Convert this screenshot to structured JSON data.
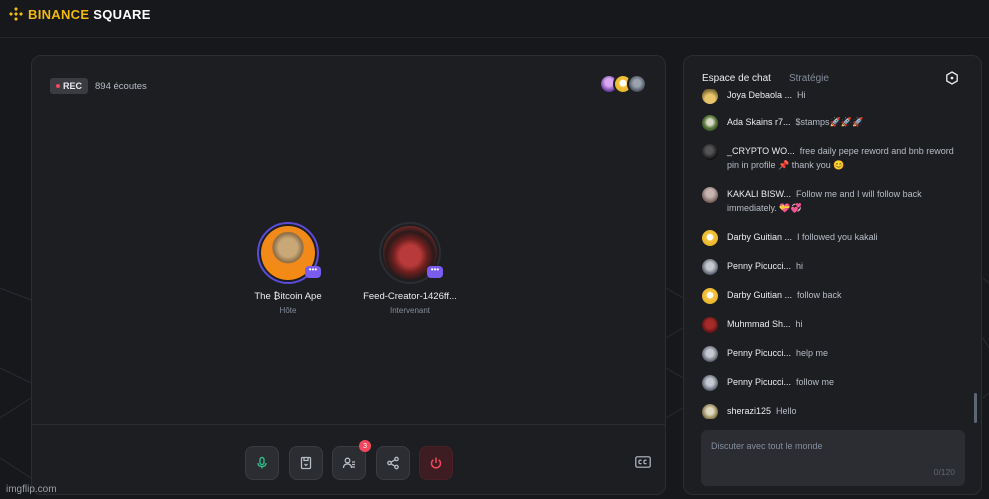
{
  "header": {
    "logo_icon": "binance-diamond-icon",
    "brand": "BINANCE",
    "product": "SQUARE",
    "brand_color": "#f0b90b"
  },
  "room": {
    "rec_label": "REC",
    "listeners": "894 écoutes",
    "speakers": [
      {
        "name": "The ₿itcoin Ape",
        "role": "Hôte"
      },
      {
        "name": "Feed-Creator-1426ff...",
        "role": "Intervenant"
      }
    ],
    "controls": {
      "mic_icon": "microphone-icon",
      "clip_icon": "clip-save-icon",
      "participants_icon": "participants-icon",
      "participants_badge": "3",
      "share_icon": "share-icon",
      "leave_icon": "power-icon",
      "cc_icon": "closed-captions-icon"
    }
  },
  "chat": {
    "tabs": {
      "active": "Espace de chat",
      "inactive": "Stratégie"
    },
    "messages": [
      {
        "user": "Joya Debaola ...",
        "text": "Hi"
      },
      {
        "user": "Ada Skains r7...",
        "text": "$stamps🚀🚀🚀"
      },
      {
        "user": "_CRYPTO WO...",
        "text": "free daily pepe reword and bnb reword pin in profile 📌 thank you 😊"
      },
      {
        "user": "KAKALI BISW...",
        "text": "Follow me and I will follow back immediately. 💝💞"
      },
      {
        "user": "Darby Guitian ...",
        "text": "I followed you kakali"
      },
      {
        "user": "Penny Picucci...",
        "text": "hi"
      },
      {
        "user": "Darby Guitian ...",
        "text": "follow back"
      },
      {
        "user": "Muhmmad Sh...",
        "text": "hi"
      },
      {
        "user": "Penny Picucci...",
        "text": "help me"
      },
      {
        "user": "Penny Picucci...",
        "text": "follow me"
      },
      {
        "user": "sherazi125",
        "text": "Hello"
      }
    ],
    "input": {
      "placeholder": "Discuter avec tout le monde",
      "counter": "0/120"
    }
  },
  "watermark": "imgflip.com"
}
